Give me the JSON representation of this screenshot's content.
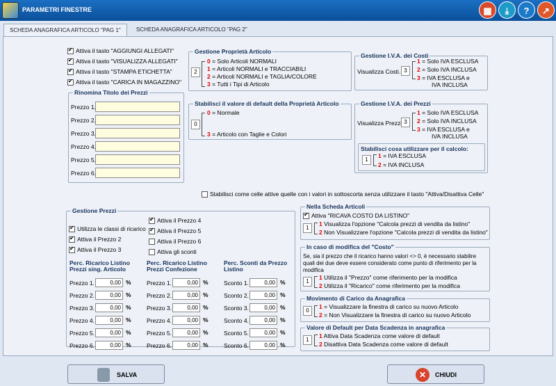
{
  "window": {
    "title": "PARAMETRI FINESTRE"
  },
  "title_buttons": {
    "calc": "▦",
    "download": "⤓",
    "help": "?",
    "exit": "↗"
  },
  "tabs": [
    "SCHEDA ANAGRAFICA ARTICOLO \"PAG 1\"",
    "SCHEDA ANAGRAFICA ARTICOLO \"PAG 2\""
  ],
  "checks": [
    "Attiva il tasto \"AGGIUNGI ALLEGATI\"",
    "Attiva il tasto \"VISUALIZZA ALLEGATI\"",
    "Attiva il tasto \"STAMPA ETICHETTA\"",
    "Attiva il tasto \"CARICA IN MAGAZZINO\""
  ],
  "rinomina": {
    "title": "Rinomina Titolo dei Prezzi",
    "labels": [
      "Prezzo 1.",
      "Prezzo 2.",
      "Prezzo 3.",
      "Prezzo 4.",
      "Prezzo 5.",
      "Prezzo 6."
    ]
  },
  "gestione_prop": {
    "title": "Gestione  Proprietà Articolo",
    "value": "2",
    "options": [
      {
        "k": "0",
        "t": "= Solo Articoli NORMALI"
      },
      {
        "k": "1",
        "t": "= Articoli NORMALI e TRACCIABILI"
      },
      {
        "k": "2",
        "t": "= Articoli NORMALI e TAGLIA/COLORE"
      },
      {
        "k": "3",
        "t": "= Tutti i Tipi di Articolo"
      }
    ]
  },
  "default_prop": {
    "title": "Stabilisci il valore di default della Proprietà Articolo",
    "value": "0",
    "options": [
      {
        "k": "0",
        "t": "= Normale"
      },
      {
        "k": "3",
        "t": "= Articolo con Taglie e Colori"
      }
    ]
  },
  "iva_costi": {
    "title": "Gestione I.V.A. dei Costi",
    "label": "Visualizza Costi..",
    "value": "3",
    "options": [
      {
        "k": "1",
        "t": "= Solo IVA ESCLUSA"
      },
      {
        "k": "2",
        "t": "= Solo IVA INCLUSA"
      },
      {
        "k": "3",
        "t": "= IVA ESCLUSA e"
      }
    ],
    "extra": "IVA  INCLUSA"
  },
  "iva_prezzi": {
    "title": "Gestione I.V.A. dei Prezzi",
    "label": "Visualizza Prezzi..",
    "value": "3",
    "options": [
      {
        "k": "1",
        "t": "= Solo IVA ESCLUSA"
      },
      {
        "k": "2",
        "t": "= Solo IVA INCLUSA"
      },
      {
        "k": "3",
        "t": "= IVA ESCLUSA e"
      }
    ],
    "extra": "IVA  INCLUSA",
    "calc_title": "Stabilisci cosa utilizzare per il calcolo:",
    "calc_value": "1",
    "calc_options": [
      {
        "k": "1",
        "t": "= IVA ESCLUSA"
      },
      {
        "k": "2",
        "t": "= IVA INCLUSA"
      }
    ]
  },
  "celle_check": "Stabilisci come celle attive quelle con i valori in sottoscorta senza utilizzare il tasto \"Attiva/Disattiva Celle\"",
  "gestione_prezzi": {
    "title": "Gestione Prezzi",
    "left_checks": [
      "Utilizza le classi di ricarico",
      "Attiva il Prezzo 2",
      "Attiva il Prezzo 3"
    ],
    "right_checks": [
      "Attiva il Prezzo 4",
      "Attiva il Prezzo 5",
      "Attiva il Prezzo 6",
      "Attiva gli sconti"
    ],
    "col1": {
      "h1": "Perc. Ricarico Listino",
      "h2": "Prezzi  sing. Articolo"
    },
    "col2": {
      "h1": "Perc. Ricarico Listino",
      "h2": "Prezzi  Confezione"
    },
    "col3": {
      "h1": "Perc. Sconti da Prezzo",
      "h2": "Listino"
    },
    "prezzo_labels": [
      "Prezzo 1.",
      "Prezzo 2.",
      "Prezzo 3.",
      "Prezzo 4.",
      "Prezzo 5.",
      "Prezzo 6."
    ],
    "sconto_labels": [
      "Sconto 1.",
      "Sconto 2.",
      "Sconto 3.",
      "Sconto 4.",
      "Sconto 5.",
      "Sconto 6."
    ],
    "value": "0,00",
    "unit": "%"
  },
  "scheda_articoli": {
    "title": "Nella Scheda Articoli",
    "check": "Attiva \"RICAVA COSTO DA LISTINO\"",
    "value": "1",
    "options": [
      {
        "k": "1",
        "t": "Visualizza l'opzione \"Calcola prezzi di vendita da listino\""
      },
      {
        "k": "2",
        "t": "Non Visualizzare l'opzione \"Calcola prezzi di vendita da listino\""
      }
    ]
  },
  "modifica_costo": {
    "title": "In caso di modifica del \"Costo\"",
    "desc": "Se, sia il prezzo che il ricarico hanno valori <> 0, è necessario stabilire quali dei due deve essere considerato come punto di riferimento per la modifica",
    "value": "1",
    "options": [
      {
        "k": "1",
        "t": "Utilizza il \"Prezzo\" come riferimento  per la modifica"
      },
      {
        "k": "2",
        "t": "Utilizza il \"Ricarico\" come riferimento per la modifica"
      }
    ]
  },
  "movimento": {
    "title": "Movimento di Carico da Anagrafica",
    "value": "0",
    "options": [
      {
        "k": "1",
        "t": "= Visualizzare la finestra di carico su nuovo Articolo"
      },
      {
        "k": "2",
        "t": "= Non Visualizzare la finestra di carico su nuovo Articolo"
      }
    ]
  },
  "scadenza": {
    "title": "Valore di Default per Data Scadenza in anagrafica",
    "value": "1",
    "options": [
      {
        "k": "1",
        "t": "Attiva Data Scadenza come valore di default"
      },
      {
        "k": "2",
        "t": "Disattiva Data Scadenza come valore di default"
      }
    ]
  },
  "buttons": {
    "save": "SALVA",
    "close": "CHIUDI"
  },
  "colors": {
    "title_bar": "#0a4f9a",
    "accent_red": "#d00000",
    "panel": "#eef2f8"
  }
}
